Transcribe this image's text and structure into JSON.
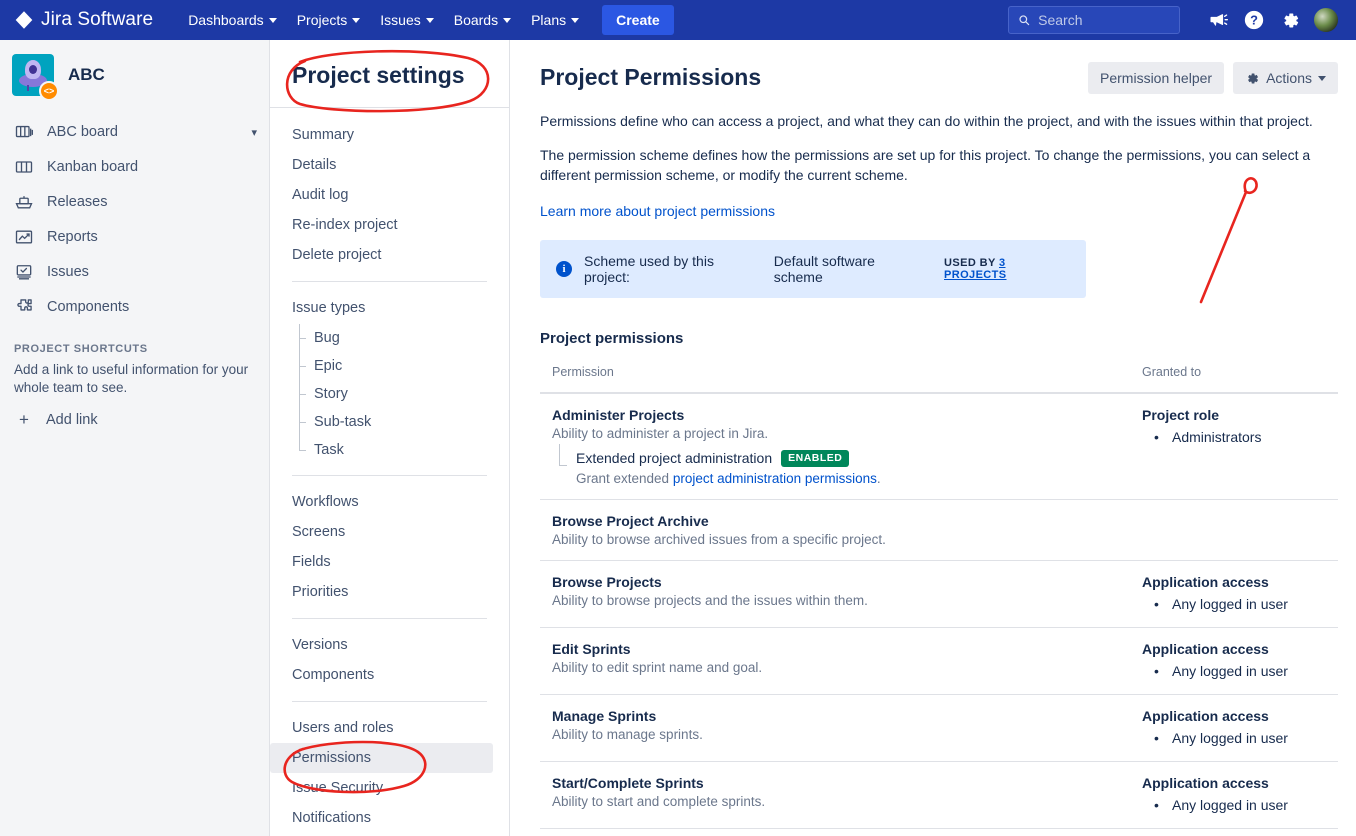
{
  "topnav": {
    "brand": "Jira Software",
    "items": [
      {
        "label": "Dashboards",
        "has_caret": true
      },
      {
        "label": "Projects",
        "has_caret": true
      },
      {
        "label": "Issues",
        "has_caret": true
      },
      {
        "label": "Boards",
        "has_caret": true
      },
      {
        "label": "Plans",
        "has_caret": true
      }
    ],
    "create_label": "Create",
    "search_placeholder": "Search",
    "search_value": "",
    "icons": [
      "search-icon",
      "megaphone-icon",
      "help-icon",
      "settings-gear-icon",
      "user-avatar"
    ],
    "background": "#1D39A5",
    "create_bg": "#2B57E3"
  },
  "project_sidebar": {
    "project_name": "ABC",
    "avatar_icon": "project-ufo-avatar",
    "badge_glyph": "<>",
    "items": [
      {
        "label": "ABC board",
        "icon": "board-stack-icon",
        "has_chevron": true
      },
      {
        "label": "Kanban board",
        "icon": "kanban-board-icon",
        "has_chevron": false
      },
      {
        "label": "Releases",
        "icon": "releases-ship-icon",
        "has_chevron": false
      },
      {
        "label": "Reports",
        "icon": "reports-chart-icon",
        "has_chevron": false
      },
      {
        "label": "Issues",
        "icon": "issues-screen-icon",
        "has_chevron": false
      },
      {
        "label": "Components",
        "icon": "components-puzzle-icon",
        "has_chevron": false
      }
    ],
    "shortcuts_heading": "PROJECT SHORTCUTS",
    "shortcuts_desc": "Add a link to useful information for your whole team to see.",
    "add_link_label": "Add link"
  },
  "settings_menu": {
    "title": "Project settings",
    "groups": [
      {
        "items": [
          {
            "label": "Summary",
            "active": false
          },
          {
            "label": "Details",
            "active": false
          },
          {
            "label": "Audit log",
            "active": false
          },
          {
            "label": "Re-index project",
            "active": false
          },
          {
            "label": "Delete project",
            "active": false
          }
        ]
      },
      {
        "items": [
          {
            "label": "Issue types",
            "active": false
          }
        ],
        "tree": [
          "Bug",
          "Epic",
          "Story",
          "Sub-task",
          "Task"
        ]
      },
      {
        "items": [
          {
            "label": "Workflows",
            "active": false
          },
          {
            "label": "Screens",
            "active": false
          },
          {
            "label": "Fields",
            "active": false
          },
          {
            "label": "Priorities",
            "active": false
          }
        ]
      },
      {
        "items": [
          {
            "label": "Versions",
            "active": false
          },
          {
            "label": "Components",
            "active": false
          }
        ]
      },
      {
        "items": [
          {
            "label": "Users and roles",
            "active": false
          },
          {
            "label": "Permissions",
            "active": true
          },
          {
            "label": "Issue Security",
            "active": false
          },
          {
            "label": "Notifications",
            "active": false
          }
        ]
      }
    ]
  },
  "main": {
    "page_title": "Project Permissions",
    "permission_helper_label": "Permission helper",
    "actions_label": "Actions",
    "paragraph1": "Permissions define who can access a project, and what they can do within the project, and with the issues within that project.",
    "paragraph2": "The permission scheme defines how the permissions are set up for this project. To change the permissions, you can select a different permission scheme, or modify the current scheme.",
    "learn_more_link": "Learn more about project permissions",
    "scheme_banner": {
      "prefix": "Scheme used by this project:",
      "scheme_name": "Default software scheme",
      "used_by_label": "USED BY",
      "used_by_link": "3 PROJECTS"
    },
    "section_title": "Project permissions",
    "table": {
      "columns": [
        "Permission",
        "Granted to"
      ],
      "rows": [
        {
          "name": "Administer Projects",
          "desc": "Ability to administer a project in Jira.",
          "sub": {
            "name": "Extended project administration",
            "badge": "ENABLED",
            "desc_prefix": "Grant extended ",
            "desc_link": "project administration permissions",
            "desc_suffix": "."
          },
          "granted_title": "Project role",
          "granted_items": [
            "Administrators"
          ]
        },
        {
          "name": "Browse Project Archive",
          "desc": "Ability to browse archived issues from a specific project.",
          "granted_title": "",
          "granted_items": []
        },
        {
          "name": "Browse Projects",
          "desc": "Ability to browse projects and the issues within them.",
          "granted_title": "Application access",
          "granted_items": [
            "Any logged in user"
          ]
        },
        {
          "name": "Edit Sprints",
          "desc": "Ability to edit sprint name and goal.",
          "granted_title": "Application access",
          "granted_items": [
            "Any logged in user"
          ]
        },
        {
          "name": "Manage Sprints",
          "desc": "Ability to manage sprints.",
          "granted_title": "Application access",
          "granted_items": [
            "Any logged in user"
          ]
        },
        {
          "name": "Start/Complete Sprints",
          "desc": "Ability to start and complete sprints.",
          "granted_title": "Application access",
          "granted_items": [
            "Any logged in user"
          ]
        }
      ]
    }
  },
  "annotations": {
    "color": "#E8251F",
    "marks": [
      {
        "name": "circle-project-settings-title",
        "shape": "ellipse"
      },
      {
        "name": "circle-permissions-menu-item",
        "shape": "ellipse"
      },
      {
        "name": "arrow-to-actions-button",
        "shape": "arrow"
      }
    ]
  }
}
